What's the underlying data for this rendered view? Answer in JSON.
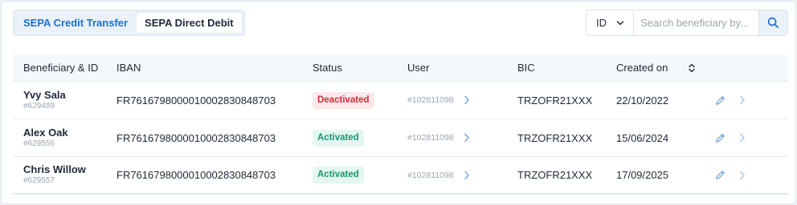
{
  "tabs": [
    {
      "label": "SEPA Credit Transfer",
      "active": true
    },
    {
      "label": "SEPA Direct Debit",
      "active": false
    }
  ],
  "search": {
    "filter_value": "ID",
    "placeholder": "Search beneficiary by..."
  },
  "table": {
    "headers": {
      "beneficiary": "Beneficiary & ID",
      "iban": "IBAN",
      "status": "Status",
      "user": "User",
      "bic": "BIC",
      "created": "Created on"
    },
    "rows": [
      {
        "name": "Yvy Sala",
        "id": "#629489",
        "iban": "FR7616798000010002830848703",
        "status": "Deactivated",
        "user": "#102811098",
        "bic": "TRZOFR21XXX",
        "created": "22/10/2022"
      },
      {
        "name": "Alex Oak",
        "id": "#629556",
        "iban": "FR7616798000010002830848703",
        "status": "Activated",
        "user": "#102811098",
        "bic": "TRZOFR21XXX",
        "created": "15/06/2024"
      },
      {
        "name": "Chris Willow",
        "id": "#629557",
        "iban": "FR7616798000010002830848703",
        "status": "Activated",
        "user": "#102811098",
        "bic": "TRZOFR21XXX",
        "created": "17/09/2025"
      }
    ]
  },
  "colors": {
    "accent": "#1e6fd1",
    "deactivated": "#d7283b",
    "activated": "#199574"
  },
  "icons": [
    "chevron-down-icon",
    "search-icon",
    "sort-icon",
    "chevron-right-icon",
    "pencil-icon"
  ]
}
